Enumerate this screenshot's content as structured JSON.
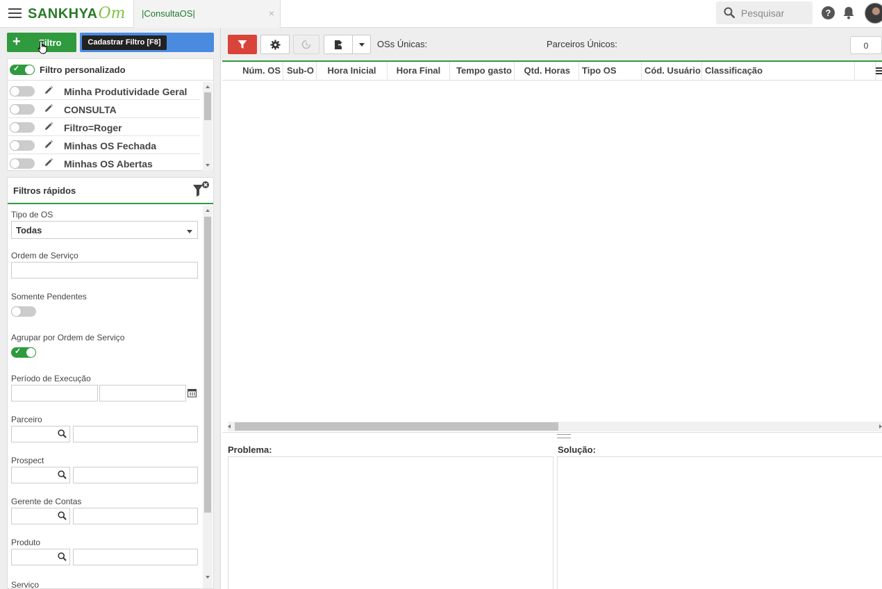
{
  "app": {
    "brand_main": "SANKHYA",
    "brand_suffix": "Om",
    "tab_label": "|ConsultaOS|",
    "tab_close": "×",
    "search_placeholder": "Pesquisar",
    "help_label": "?"
  },
  "colors": {
    "brand_green": "#2a7a2a",
    "accent_green": "#2f9a3e",
    "filter_red": "#d9443a",
    "blue": "#4a8be0"
  },
  "left": {
    "filtro_button_plus": "+",
    "filtro_button_label": "Filtro",
    "tooltip": "Cadastrar Filtro [F8]",
    "custom_filter_label": "Filtro personalizado",
    "custom_filter_on": true,
    "saved_filters": [
      {
        "name": "Minha Produtividade Geral",
        "on": false
      },
      {
        "name": "CONSULTA",
        "on": false
      },
      {
        "name": "Filtro=Roger",
        "on": false
      },
      {
        "name": "Minhas OS Fechada",
        "on": false
      },
      {
        "name": "Minhas OS Abertas",
        "on": false
      }
    ],
    "quick_filters_title": "Filtros rápidos",
    "fields": {
      "tipo_os_label": "Tipo de OS",
      "tipo_os_value": "Todas",
      "ordem_servico_label": "Ordem de Serviço",
      "somente_pendentes_label": "Somente Pendentes",
      "somente_pendentes_on": false,
      "agrupar_label": "Agrupar por Ordem de Serviço",
      "agrupar_on": true,
      "periodo_label": "Período de Execução",
      "parceiro_label": "Parceiro",
      "prospect_label": "Prospect",
      "gerente_label": "Gerente de Contas",
      "produto_label": "Produto",
      "servico_label": "Serviço"
    }
  },
  "toolbar": {
    "oss_unicas_label": "OSs Únicas:",
    "parceiros_unicos_label": "Parceiros Únicos:",
    "count_value": "0"
  },
  "grid": {
    "columns": [
      "Núm. OS",
      "Sub-O",
      "Hora Inicial",
      "Hora Final",
      "Tempo gasto",
      "Qtd. Horas",
      "Tipo OS",
      "Cód. Usuário",
      "Classificação"
    ]
  },
  "detail": {
    "problema_label": "Problema:",
    "solucao_label": "Solução:"
  }
}
